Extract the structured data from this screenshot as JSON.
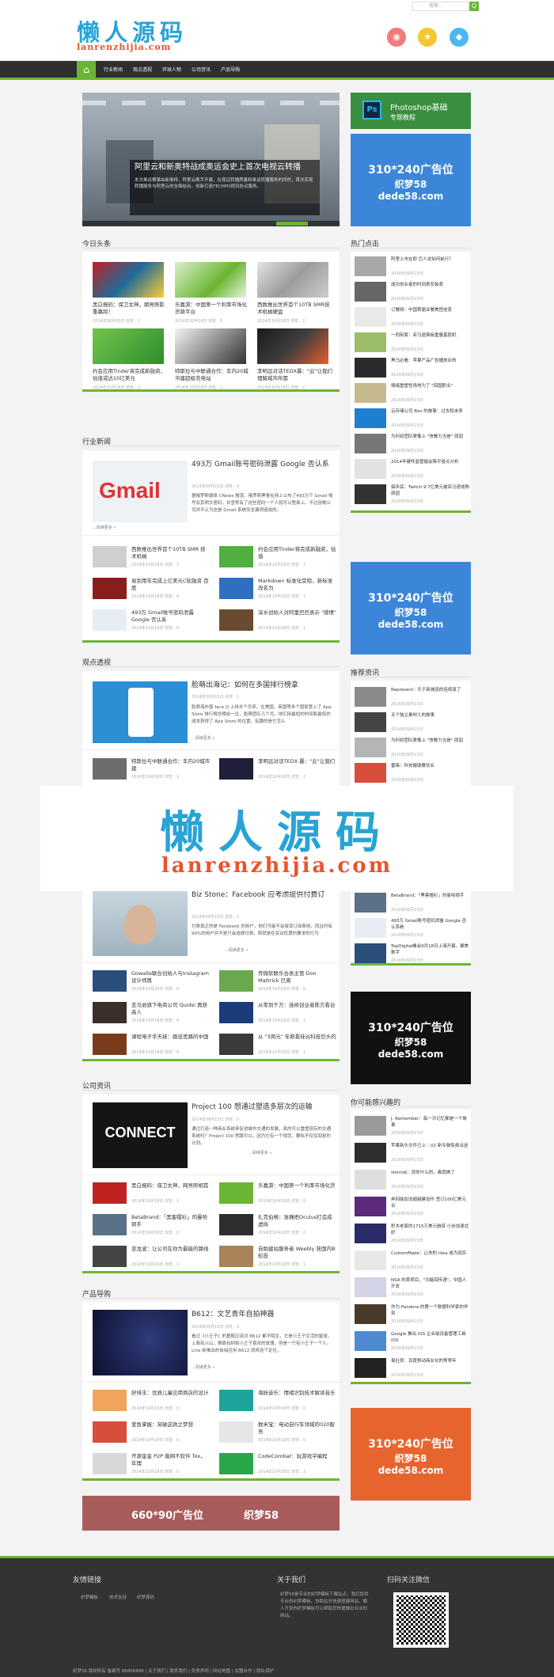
{
  "header": {
    "logo_cn": "懒人源码",
    "logo_en": "lanrenzhijia.com",
    "search_placeholder": "搜索...",
    "search_button": "Q",
    "social": [
      {
        "name": "weibo-icon",
        "color": "#f07b78",
        "glyph": "◉"
      },
      {
        "name": "star-icon",
        "color": "#f5c62f",
        "glyph": "★"
      },
      {
        "name": "qq-icon",
        "color": "#4bb9ef",
        "glyph": "◆"
      }
    ]
  },
  "nav": {
    "home": "⌂",
    "items": [
      "行业新闻",
      "观点透视",
      "环球人物",
      "公司资讯",
      "产品导购"
    ]
  },
  "slider": {
    "caption": "阿里云和新奥特战成奥运会史上首次电视云转播",
    "desc": "本次奥运赛事由新奥特，阿里云携手开展，在保证转播质量和奥运转播服务的同时，首次实现转播服务与阿里云的全面结合，创新打造TECHPO视讯协议服务。"
  },
  "ps_banner": {
    "title": "Photoshop基础",
    "sub": "专题教程",
    "icon": "Ps"
  },
  "ads": {
    "line1": "310*240广告位",
    "line2": "织梦58",
    "line3": "dede58.com",
    "bottom_left": "660*90广告位",
    "bottom_right": "织梦58"
  },
  "colors": {
    "accent": "#6ab533",
    "blue_ad": "#3b86d9",
    "dark_ad": "#111111",
    "orange_ad": "#e8642f",
    "bottom_ad": "#a85c5c"
  },
  "today": {
    "title": "今日头条",
    "items": [
      {
        "title": "黑白报码：保卫女神，網亮照影重幕跨！",
        "meta": "2014年08月20日 浏览：1"
      },
      {
        "title": "乐嘉游：中国第一个利率市场化货款平台",
        "meta": "2014年10月18日 浏览：0"
      },
      {
        "title": "西数推出世界首个10TB SMR技术机械硬盘",
        "meta": "2014年10月18日 浏览：2"
      },
      {
        "title": "约会应用Tinder将完成新融资，估值或达10亿美元",
        "meta": "2014年10月18日 浏览：2"
      },
      {
        "title": "特斯拉与中联通合作：车内20城市建超级充电站",
        "meta": "2014年10月18日 浏览：1"
      },
      {
        "title": "李明远对话TEDX暴：\"云\"让我们理解城市所需",
        "meta": "2014年10月18日 浏览：2"
      }
    ]
  },
  "industry": {
    "title": "行业新闻",
    "feature_title": "493万 Gmail账号密码泄露 Google 否认系",
    "feature_meta": "2014年09月15日 浏览：0",
    "feature_desc": "据俄罗斯媒体 CNews 报道，俄罗斯黑客在网上公布了493万个 Gmail 账号及其明文密码，并宣称有了这些密码一个人就可以登录上。不过谷歌公司并不认为这是 Gmail 系统安全漏洞造成的。",
    "feature_more": "...阅读更多 »",
    "items": [
      {
        "title": "西数推出世界首个10TB SMR 技术机械",
        "meta": "2014年10月18日 浏览：2"
      },
      {
        "title": "约会应用Tinder将完成新融资，估值",
        "meta": "2014年10月18日 浏览：2"
      },
      {
        "title": "易到用车完成上亿美元C轮融资 百度",
        "meta": "2014年10月18日 浏览：0"
      },
      {
        "title": "Markdown 标准化受阻，新标准改名为",
        "meta": "2014年10月18日 浏览：1"
      },
      {
        "title": "493万 Gmail账号密码泄露 Google 否认系",
        "meta": "2014年10月18日 浏览：0"
      },
      {
        "title": "深水创始人对阿里巴巴表示 \"感情\"",
        "meta": "2014年10月18日 浏览：1"
      }
    ]
  },
  "viewpoint": {
    "title": "观点透视",
    "feature_title": "脸萌出海记：如何在多国排行榜拿",
    "feature_meta": "2014年09月15日 浏览：1",
    "feature_desc": "脸萌海外版 face Q 上线半个月来，在美国、英国等多个国家登上了 App Store 排行榜总榜前一位，脸萌团队几个月，他们用最短的时间和最低的成本获得了 App Store 的位置。有趣的是它怎么",
    "feature_more": "...阅读更多 »",
    "items": [
      {
        "title": "特斯拉与中联通合作：车内20城市建",
        "meta": "2014年10月18日 浏览：1"
      },
      {
        "title": "李明远对话TEDX 暴：\"云\"让我们",
        "meta": "2014年10月18日 浏览：2"
      }
    ]
  },
  "watermark": {
    "cn": "懒人源码",
    "en": "lanrenzhijia.com"
  },
  "people": {
    "feature_title": "Biz Stone：Facebook 应考虑提供付费订",
    "feature_meta": "2014年09月15日 浏览：0",
    "feature_desc": "付费真正的是 Facebook 的用户，他们可能不会接受订阅费用，而且时有90%的用户并不是只会选择付费，那就是在变动优惠的要求的行为",
    "feature_more": "...阅读更多 »",
    "items": [
      {
        "title": "Gowalla联合创始人与Instagram设计师再",
        "meta": "2014年10月18日 浏览：0"
      },
      {
        "title": "传微软联乐合表主管 Don Mattrick 已离",
        "meta": "2014年10月18日 浏览：0"
      },
      {
        "title": "亚马逊旗下电商公司 Quidsi 再获高人",
        "meta": "2014年10月18日 浏览：0"
      },
      {
        "title": "从零到千万：连续创业者陈方看台",
        "meta": "2014年10月18日 浏览：1"
      },
      {
        "title": "课程电子手天妹：路径思路的中国",
        "meta": "2014年10月18日 浏览：0"
      },
      {
        "title": "从 \"3周元\" 年薪看硅谷科技巨头的",
        "meta": "2014年10月18日 浏览：1"
      }
    ]
  },
  "company": {
    "title": "公司资讯",
    "feature_title": "Project 100 想通过塑造多层次的运输",
    "feature_meta": "2014年09月15日 浏览：0",
    "feature_desc": "通过打造一种商业系统来促进城市交通的发展，真的可以重塑现存的交通系统吗？Project 100 思路可以，因为它有一个规范，要拟不仅仅回复的计划。",
    "feature_more": "...阅读更多 »",
    "thumb_text": "CONNECT",
    "items": [
      {
        "title": "黑白报码：保卫女神，网亮照相首",
        "meta": "2014年10月18日 浏览：1"
      },
      {
        "title": "乐嘉游：中国第一个利率市场化货",
        "meta": "2014年10月18日 浏览：0"
      },
      {
        "title": "BetaBrand：「黑客帽衫」的曼哈顿手",
        "meta": "2014年10月18日 浏览：0"
      },
      {
        "title": "扎克伯格：准确把Oculus打造成虚拟",
        "meta": "2014年10月18日 浏览：0"
      },
      {
        "title": "亚龙波：让公司在你为最能的路线",
        "meta": "2014年10月18日 浏览：1"
      },
      {
        "title": "自助建站服务者 Weebly 获国内B轮投",
        "meta": "2014年10月18日 浏览：1"
      }
    ]
  },
  "product": {
    "title": "产品导购",
    "feature_title": "B612：文艺青年自拍神器",
    "feature_meta": "2014年09月15日 浏览：0",
    "feature_desc": "看过《小王子》的童鞋应该对 B612 都不陌生，它是小王子生活的星球，上面有火山，猴面包树和小王子喜欢的玫瑰，但是一只有小王子一个人。Line 新推出的自拍应用 B612 就将这个定位，",
    "feature_more": "...阅读更多 »",
    "items": [
      {
        "title": "好排丰：优质儿童应用商店的设计",
        "meta": "2014年10月18日 浏览：0"
      },
      {
        "title": "海妖音乐：情绪识别技术解读音乐",
        "meta": "2014年10月18日 浏览：0"
      },
      {
        "title": "爱鱼掌握：突破这款之梦想",
        "meta": "2014年10月18日 浏览：0"
      },
      {
        "title": "数米宝：电动自行车领域的020服务",
        "meta": "2014年10月18日 浏览：0"
      },
      {
        "title": "开源金金 P2P 版网不软件 Tox，年理",
        "meta": "2014年10月18日 浏览：0"
      },
      {
        "title": "CodeCombat：玩游戏学编程",
        "meta": "2014年10月18日 浏览：1"
      }
    ]
  },
  "hot": {
    "title": "热门点击",
    "items": [
      {
        "title": "阿里上市在即 巨人说如何前行？",
        "meta": "2014年09月15日"
      },
      {
        "title": "成功创业者的时间表安装表",
        "meta": "2014年09月15日"
      },
      {
        "title": "订餐网：中国首届业餐美团信息",
        "meta": "2014年09月15日"
      },
      {
        "title": "一同街套：亚马逊面板重量基层机",
        "meta": "2014年09月15日"
      },
      {
        "title": "黑马必看：苹果产品广告播放业的",
        "meta": "2014年09月15日"
      },
      {
        "title": "情绪重塑性场地为了 \"回国职业\"",
        "meta": "2014年09月15日"
      },
      {
        "title": "云存储公司 Box 的故事：过去和未来",
        "meta": "2014年09月15日"
      },
      {
        "title": "为何初团队更像上 \"快餐力当是\" 原因",
        "meta": "2014年09月15日"
      },
      {
        "title": "2014年硬件监管催会降平投点分析",
        "meta": "2014年09月15日"
      },
      {
        "title": "搞年底：Twitch 9.7亿美元被亚马逊收购原因",
        "meta": "2014年09月15日"
      }
    ]
  },
  "recommend": {
    "title": "推荐资讯",
    "items": [
      {
        "title": "Represent：乐于新城连的连续真了",
        "meta": "2014年09月15日"
      },
      {
        "title": "五个独立素材人的故事",
        "meta": "2014年09月15日"
      },
      {
        "title": "为何初团队更像上 \"快餐力当是\" 原因",
        "meta": "2014年09月15日"
      },
      {
        "title": "雷锋：科技健康餐饮业",
        "meta": "2014年09月15日"
      },
      {
        "title": "BetaBrand：「黑客帽衫」的曼哈顿手",
        "meta": "2014年09月15日"
      },
      {
        "title": "493万 Gmail账号密码泄露 Google 否认系统",
        "meta": "2014年09月15日"
      },
      {
        "title": "TopDigital峰会9月18日上海开幕，聚焦数字",
        "meta": "2014年09月15日"
      }
    ]
  },
  "maylike": {
    "title": "你可能感兴趣的",
    "items": [
      {
        "title": "J. Remember：每一次记忆都是一个故事",
        "meta": "2014年09月15日"
      },
      {
        "title": "苹果新头文件已上：U2 新专辑免费派送",
        "meta": "2014年09月15日"
      },
      {
        "title": "slimrob：改你什么的，离竟做了",
        "meta": "2014年09月15日"
      },
      {
        "title": "奔别能加法超越建设作 签订100亿美元合",
        "meta": "2014年09月15日"
      },
      {
        "title": "积木老家的1715万美元融资 小米加速式好",
        "meta": "2014年09月15日"
      },
      {
        "title": "CustomMade：让你的 idea 成为现实",
        "meta": "2014年09月15日"
      },
      {
        "title": "NSA 的首项目，\"功能回传递\"，中国人开发",
        "meta": "2014年09月15日"
      },
      {
        "title": "作为 Pandora 的第一个数据科学家的学到",
        "meta": "2014年09月15日"
      },
      {
        "title": "Google 推出 iOS 企业级设备管理工具 iOS",
        "meta": "2014年09月15日"
      },
      {
        "title": "易社员：百度移动商业化的零零年",
        "meta": "2014年09月15日"
      }
    ]
  },
  "footer": {
    "links_title": "友情链接",
    "links": [
      "织梦模板",
      "技术支持",
      "织梦源码"
    ],
    "about_title": "关于我们",
    "about_text": "织梦58是专业的织梦模板下载站点，我们提供专业的织梦模板，协助站长快速搭建网站，懒人开发的织梦模板可以帮助您快速做出专业的网站。",
    "qr_title": "扫码关注微信",
    "bottom": "织梦58 版权所有 备案号 88888888 | 关于我们 | 联系我们 | 免责声明 | 网站地图 | 加盟合作 | 隐私保护"
  }
}
